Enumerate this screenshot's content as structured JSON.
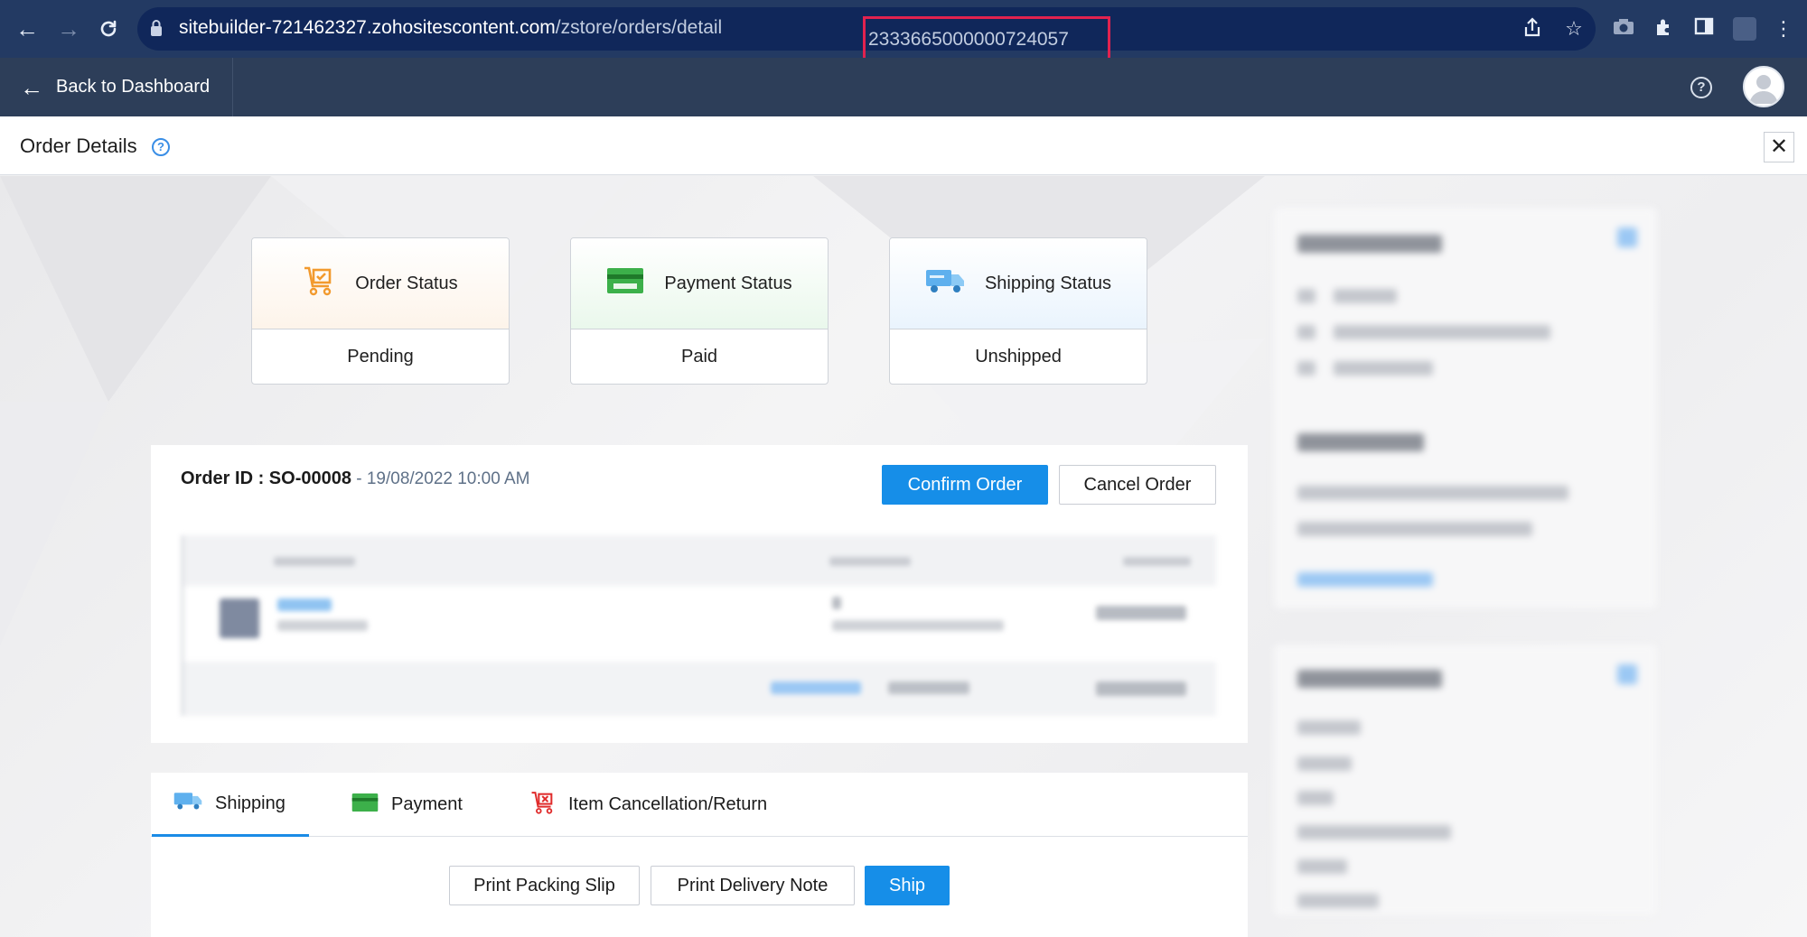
{
  "browser": {
    "url_host": "sitebuilder-721462327.zohositescontent.com",
    "url_path": "/zstore/orders/detail",
    "url_highlight": "2333665000000724057"
  },
  "app_header": {
    "back_label": "Back to Dashboard"
  },
  "title_bar": {
    "title": "Order Details"
  },
  "status_cards": [
    {
      "label": "Order Status",
      "value": "Pending",
      "icon": "cart-check-icon",
      "color": "#f29a2e"
    },
    {
      "label": "Payment Status",
      "value": "Paid",
      "icon": "credit-card-icon",
      "color": "#3cb04a"
    },
    {
      "label": "Shipping Status",
      "value": "Unshipped",
      "icon": "truck-icon",
      "color": "#5eb0ee"
    }
  ],
  "order": {
    "id_label": "Order ID : SO-00008",
    "date": " - 19/08/2022 10:00 AM",
    "confirm_label": "Confirm Order",
    "cancel_label": "Cancel Order"
  },
  "tabs": [
    {
      "label": "Shipping",
      "icon": "truck-icon",
      "active": true
    },
    {
      "label": "Payment",
      "icon": "credit-card-icon",
      "active": false
    },
    {
      "label": "Item Cancellation/Return",
      "icon": "cart-cancel-icon",
      "active": false
    }
  ],
  "shipping_actions": {
    "print_packing_slip": "Print Packing Slip",
    "print_delivery_note": "Print Delivery Note",
    "ship": "Ship"
  },
  "colors": {
    "primary": "#168ee8",
    "chrome_bg": "#233a63",
    "app_header_bg": "#2d3e59",
    "highlight_border": "#e1224f"
  }
}
